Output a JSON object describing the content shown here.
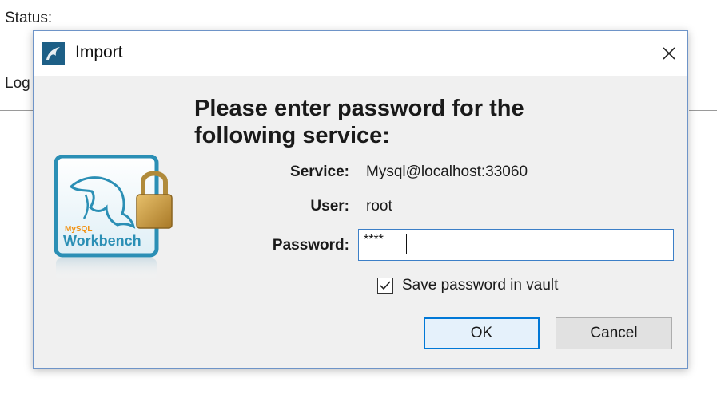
{
  "background": {
    "status_label": "Status:",
    "log_label": "Log"
  },
  "dialog": {
    "title": "Import",
    "heading": "Please enter password for the following service:",
    "service_label": "Service:",
    "service_value": "Mysql@localhost:33060",
    "user_label": "User:",
    "user_value": "root",
    "password_label": "Password:",
    "password_value": "****",
    "save_password_label": "Save password in vault",
    "save_password_checked": true,
    "ok_label": "OK",
    "cancel_label": "Cancel",
    "logo_text_small": "MySQL",
    "logo_text": "Workbench"
  },
  "colors": {
    "accent": "#0078d7",
    "logo_teal": "#2b8fb5",
    "lock_gold": "#c99a3c"
  }
}
